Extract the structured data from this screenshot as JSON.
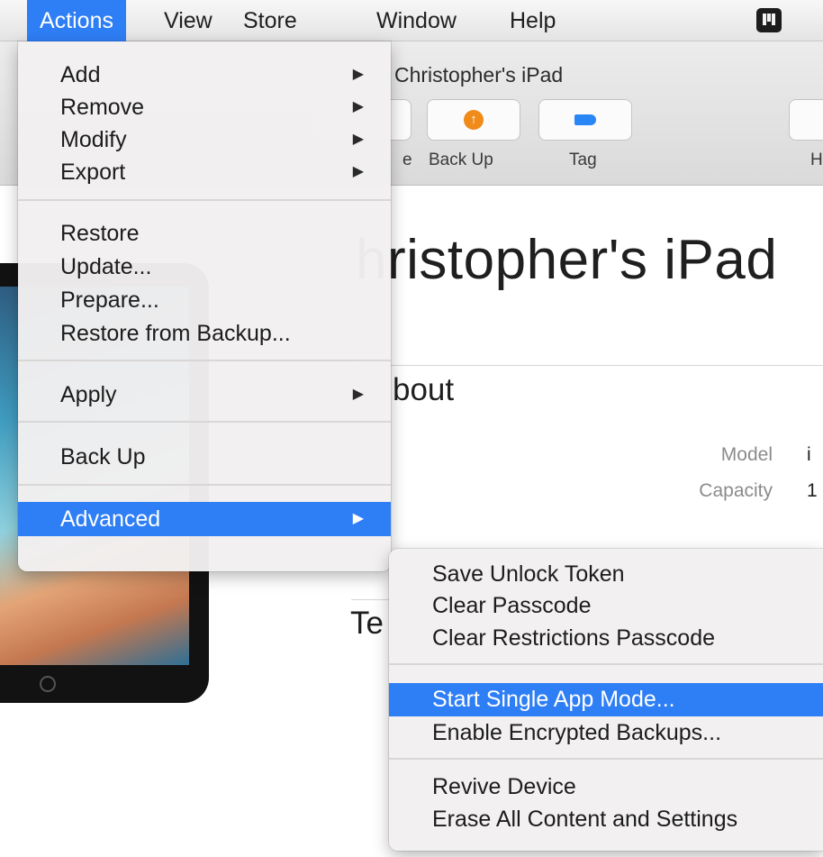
{
  "menubar": {
    "items": [
      "Actions",
      "View",
      "Store",
      "Window",
      "Help"
    ],
    "active": "Actions"
  },
  "window": {
    "title": "Christopher's iPad",
    "toolbar": {
      "left_partial_label": "e",
      "backup_label": "Back Up",
      "tag_label": "Tag",
      "right_partial_label": "H"
    },
    "device_heading": "hristopher's iPad",
    "about_heading": "bout",
    "info": [
      {
        "label": "Model",
        "value": "i"
      },
      {
        "label": "Capacity",
        "value": "1"
      }
    ],
    "te_heading": "Te"
  },
  "actions_menu": {
    "items": [
      {
        "label": "Add",
        "submenu": true
      },
      {
        "label": "Remove",
        "submenu": true
      },
      {
        "label": "Modify",
        "submenu": true
      },
      {
        "label": "Export",
        "submenu": true
      },
      {
        "label": "Restore",
        "submenu": false
      },
      {
        "label": "Update...",
        "submenu": false
      },
      {
        "label": "Prepare...",
        "submenu": false
      },
      {
        "label": "Restore from Backup...",
        "submenu": false
      },
      {
        "label": "Apply",
        "submenu": true
      },
      {
        "label": "Back Up",
        "submenu": false
      },
      {
        "label": "Advanced",
        "submenu": true,
        "highlighted": true
      }
    ]
  },
  "advanced_menu": {
    "items": [
      {
        "label": "Save Unlock Token"
      },
      {
        "label": "Clear Passcode"
      },
      {
        "label": "Clear Restrictions Passcode"
      },
      {
        "label": "Start Single App Mode...",
        "highlighted": true
      },
      {
        "label": "Enable Encrypted Backups..."
      },
      {
        "label": "Revive Device"
      },
      {
        "label": "Erase All Content and Settings"
      }
    ]
  },
  "colors": {
    "highlight": "#2e7ef5",
    "backup_icon": "#f08a18",
    "tag_icon": "#2a86f5"
  },
  "icons": {
    "submenu_arrow": "▶",
    "tray": "app-tray-icon",
    "backup": "backup-arrow-icon",
    "tag": "tag-icon"
  }
}
